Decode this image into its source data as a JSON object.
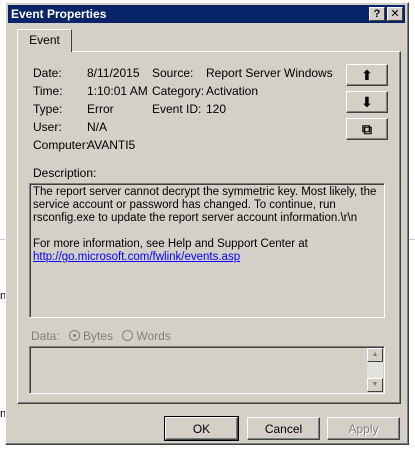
{
  "window": {
    "title": "Event Properties",
    "help_glyph": "?",
    "close_glyph": "✕"
  },
  "tab": {
    "label": "Event"
  },
  "fields": {
    "date_label": "Date:",
    "date_value": "8/11/2015",
    "time_label": "Time:",
    "time_value": "1:10:01 AM",
    "type_label": "Type:",
    "type_value": "Error",
    "user_label": "User:",
    "user_value": "N/A",
    "computer_label": "Computer:",
    "computer_value": "AVANTI5",
    "source_label": "Source:",
    "source_value": "Report Server Windows",
    "category_label": "Category:",
    "category_value": "Activation",
    "eventid_label": "Event ID:",
    "eventid_value": "120"
  },
  "nav": {
    "up_glyph": "⬆",
    "down_glyph": "⬇",
    "copy_glyph": "⧉"
  },
  "description": {
    "label": "Description:",
    "text": "The report server cannot decrypt the symmetric key. Most likely, the service account or password has changed. To continue, run rsconfig.exe to update the report server account information.\\r\\n",
    "more_info": "For more information, see Help and Support Center at",
    "link": "http://go.microsoft.com/fwlink/events.asp"
  },
  "data": {
    "label": "Data:",
    "bytes_label": "Bytes",
    "words_label": "Words",
    "selected": "Bytes"
  },
  "buttons": {
    "ok": "OK",
    "cancel": "Cancel",
    "apply": "Apply"
  },
  "colors": {
    "titlebar": "#0a246a",
    "face": "#d4d0c8",
    "link": "#0000ff"
  }
}
